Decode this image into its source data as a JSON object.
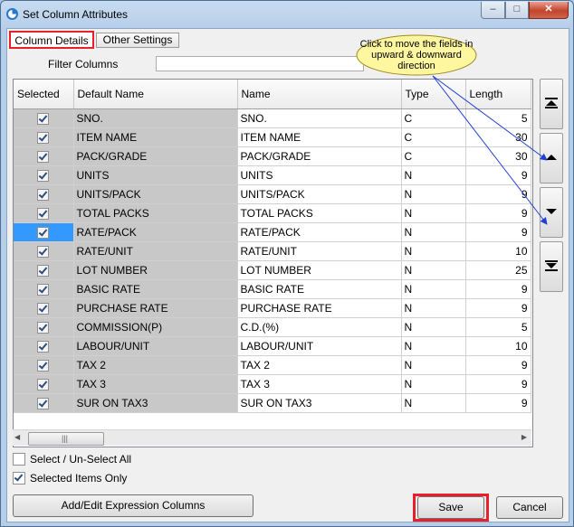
{
  "window": {
    "title": "Set Column Attributes"
  },
  "tabs": [
    "Column Details",
    "Other Settings"
  ],
  "filter": {
    "label": "Filter Columns",
    "value": ""
  },
  "callout": {
    "text": "Click to move the fields in upward & downward direction"
  },
  "grid": {
    "columns": [
      "Selected",
      "Default Name",
      "Name",
      "Type",
      "Length"
    ],
    "rows": [
      {
        "selected": true,
        "default_name": "SNO.",
        "name": "SNO.",
        "type": "C",
        "length": "5"
      },
      {
        "selected": true,
        "default_name": "ITEM NAME",
        "name": "ITEM NAME",
        "type": "C",
        "length": "30"
      },
      {
        "selected": true,
        "default_name": "PACK/GRADE",
        "name": "PACK/GRADE",
        "type": "C",
        "length": "30"
      },
      {
        "selected": true,
        "default_name": "UNITS",
        "name": "UNITS",
        "type": "N",
        "length": "9"
      },
      {
        "selected": true,
        "default_name": "UNITS/PACK",
        "name": "UNITS/PACK",
        "type": "N",
        "length": "9"
      },
      {
        "selected": true,
        "default_name": "TOTAL PACKS",
        "name": "TOTAL PACKS",
        "type": "N",
        "length": "9"
      },
      {
        "selected": true,
        "default_name": "RATE/PACK",
        "name": "RATE/PACK",
        "type": "N",
        "length": "9",
        "current": true
      },
      {
        "selected": true,
        "default_name": "RATE/UNIT",
        "name": "RATE/UNIT",
        "type": "N",
        "length": "10"
      },
      {
        "selected": true,
        "default_name": "LOT NUMBER",
        "name": "LOT NUMBER",
        "type": "N",
        "length": "25"
      },
      {
        "selected": true,
        "default_name": "BASIC RATE",
        "name": "BASIC RATE",
        "type": "N",
        "length": "9"
      },
      {
        "selected": true,
        "default_name": "PURCHASE RATE",
        "name": "PURCHASE RATE",
        "type": "N",
        "length": "9"
      },
      {
        "selected": true,
        "default_name": "COMMISSION(P)",
        "name": "C.D.(%)",
        "type": "N",
        "length": "5"
      },
      {
        "selected": true,
        "default_name": "LABOUR/UNIT",
        "name": "LABOUR/UNIT",
        "type": "N",
        "length": "10"
      },
      {
        "selected": true,
        "default_name": "TAX 2",
        "name": "TAX 2",
        "type": "N",
        "length": "9"
      },
      {
        "selected": true,
        "default_name": "TAX 3",
        "name": "TAX 3",
        "type": "N",
        "length": "9"
      },
      {
        "selected": true,
        "default_name": "SUR ON TAX3",
        "name": "SUR ON TAX3",
        "type": "N",
        "length": "9"
      }
    ]
  },
  "side_buttons": [
    {
      "name": "move-to-top",
      "icon": "move-top-icon"
    },
    {
      "name": "move-up",
      "icon": "move-up-icon"
    },
    {
      "name": "move-down",
      "icon": "move-down-icon"
    },
    {
      "name": "move-to-bottom",
      "icon": "move-bottom-icon"
    }
  ],
  "options": {
    "select_all": {
      "label": "Select / Un-Select All",
      "checked": false
    },
    "selected_only": {
      "label": "Selected Items Only",
      "checked": true
    }
  },
  "buttons": {
    "add_edit": "Add/Edit Expression Columns",
    "save": "Save",
    "cancel": "Cancel"
  },
  "colors": {
    "highlight_red": "#e8202a",
    "selection_blue": "#3399ff",
    "arrow_blue": "#1f3fd6",
    "callout_fill": "#fff6a0"
  }
}
